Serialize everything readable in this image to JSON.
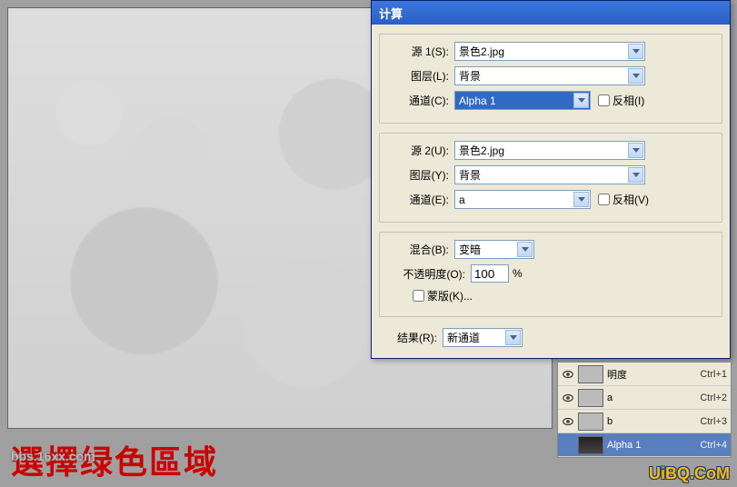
{
  "canvas": {
    "desc": "grayscale-fruit-image"
  },
  "dialog": {
    "title": "计算",
    "source1": {
      "label": "源 1(S):",
      "value": "景色2.jpg",
      "layer_label": "图层(L):",
      "layer_value": "背景",
      "channel_label": "通道(C):",
      "channel_value": "Alpha 1",
      "invert_label": "反相(I)"
    },
    "source2": {
      "label": "源 2(U):",
      "value": "景色2.jpg",
      "layer_label": "图层(Y):",
      "layer_value": "背景",
      "channel_label": "通道(E):",
      "channel_value": "a",
      "invert_label": "反相(V)"
    },
    "blend": {
      "label": "混合(B):",
      "value": "变暗",
      "opacity_label": "不透明度(O):",
      "opacity_value": "100",
      "opacity_pct": "%",
      "mask_label": "蒙版(K)..."
    },
    "result": {
      "label": "结果(R):",
      "value": "新通道"
    }
  },
  "channels": {
    "items": [
      {
        "name": "明度",
        "shortcut": "Ctrl+1",
        "visible": true
      },
      {
        "name": "a",
        "shortcut": "Ctrl+2",
        "visible": true
      },
      {
        "name": "b",
        "shortcut": "Ctrl+3",
        "visible": true
      },
      {
        "name": "Alpha 1",
        "shortcut": "Ctrl+4",
        "visible": false,
        "selected": true
      }
    ]
  },
  "overlay": {
    "red_text": "選擇绿色區域",
    "bbs": "bbs.16xx.com"
  },
  "watermark": "UiBQ.CoM"
}
